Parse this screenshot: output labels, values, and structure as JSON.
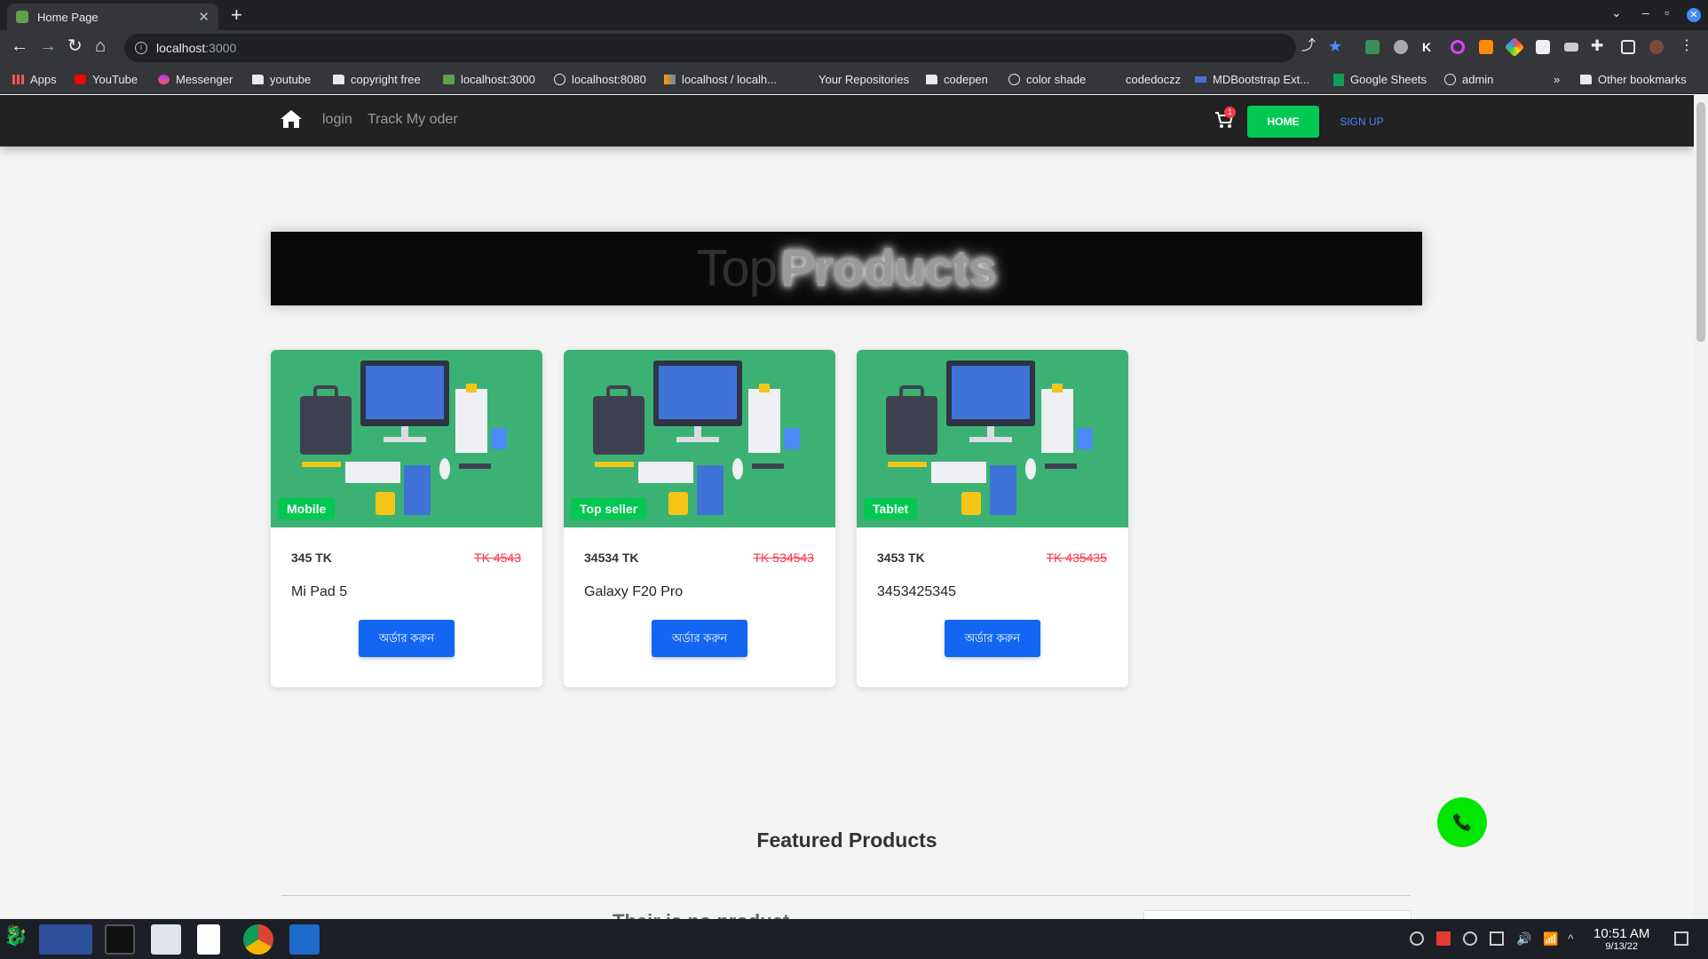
{
  "browser": {
    "tab_title": "Home Page",
    "url_host": "localhost",
    "url_port": ":3000",
    "bookmarks": [
      {
        "label": "Apps",
        "icon": "apps-grid-icon"
      },
      {
        "label": "YouTube",
        "icon": "youtube-icon"
      },
      {
        "label": "Messenger",
        "icon": "messenger-icon"
      },
      {
        "label": "youtube",
        "icon": "folder-icon"
      },
      {
        "label": "copyright free",
        "icon": "folder-icon"
      },
      {
        "label": "localhost:3000",
        "icon": "shopify-icon"
      },
      {
        "label": "localhost:8080",
        "icon": "globe-icon"
      },
      {
        "label": "localhost / localh...",
        "icon": "phpmyadmin-icon"
      },
      {
        "label": "Your Repositories",
        "icon": "github-icon"
      },
      {
        "label": "codepen",
        "icon": "folder-icon"
      },
      {
        "label": "color shade",
        "icon": "globe-icon"
      },
      {
        "label": "codedoczz",
        "icon": "blank-page-icon"
      },
      {
        "label": "MDBootstrap Ext...",
        "icon": "mdb-icon"
      },
      {
        "label": "Google Sheets",
        "icon": "google-sheets-icon"
      },
      {
        "label": "admin",
        "icon": "globe-icon"
      }
    ],
    "overflow": "»",
    "other_bookmarks": "Other bookmarks"
  },
  "navbar": {
    "login": "login",
    "track": "Track My oder",
    "cart_count": "1",
    "home_button": "HOME",
    "signup_button": "SIGN UP"
  },
  "hero": {
    "word1": "Top",
    "word2": "Products"
  },
  "products": [
    {
      "badge": "Mobile",
      "price": "345 TK",
      "old_price": "TK 4543",
      "name": "Mi Pad 5",
      "button": "অর্ডার করুন"
    },
    {
      "badge": "Top seller",
      "price": "34534 TK",
      "old_price": "TK 534543",
      "name": "Galaxy F20 Pro",
      "button": "অর্ডার করুন"
    },
    {
      "badge": "Tablet",
      "price": "3453 TK",
      "old_price": "TK 435435",
      "name": "3453425345",
      "button": "অর্ডার করুন"
    }
  ],
  "featured": {
    "title": "Featured Products",
    "empty_text": "Their is no product"
  },
  "taskbar": {
    "time": "10:51 AM",
    "date": "9/13/22"
  },
  "colors": {
    "accent_green": "#00c851",
    "button_blue": "#1266f1",
    "price_red": "#ff3547",
    "card_image_bg": "#3bb273"
  }
}
